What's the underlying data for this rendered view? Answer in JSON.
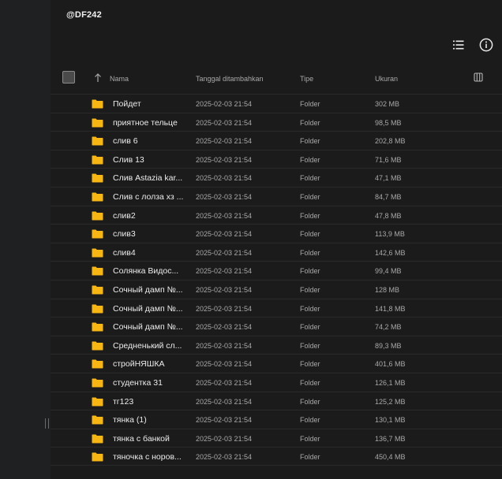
{
  "header": {
    "title": "@DF242"
  },
  "columns": {
    "name": "Nama",
    "date": "Tanggal ditambahkan",
    "type": "Tipe",
    "size": "Ukuran"
  },
  "colors": {
    "folder": "#f7b614",
    "background": "#1b1b1b",
    "sidebar": "#1f2022"
  },
  "rows": [
    {
      "name": "Пойдет",
      "date": "2025-02-03 21:54",
      "type": "Folder",
      "size": "302 MB"
    },
    {
      "name": "приятное тельце",
      "date": "2025-02-03 21:54",
      "type": "Folder",
      "size": "98,5 MB"
    },
    {
      "name": "слив 6",
      "date": "2025-02-03 21:54",
      "type": "Folder",
      "size": "202,8 MB"
    },
    {
      "name": "Слив 13",
      "date": "2025-02-03 21:54",
      "type": "Folder",
      "size": "71,6 MB"
    },
    {
      "name": "Слив Astazia kar...",
      "date": "2025-02-03 21:54",
      "type": "Folder",
      "size": "47,1 MB"
    },
    {
      "name": "Слив с лолза хз ...",
      "date": "2025-02-03 21:54",
      "type": "Folder",
      "size": "84,7 MB"
    },
    {
      "name": "слив2",
      "date": "2025-02-03 21:54",
      "type": "Folder",
      "size": "47,8 MB"
    },
    {
      "name": "слив3",
      "date": "2025-02-03 21:54",
      "type": "Folder",
      "size": "113,9 MB"
    },
    {
      "name": "слив4",
      "date": "2025-02-03 21:54",
      "type": "Folder",
      "size": "142,6 MB"
    },
    {
      "name": "Солянка Видос...",
      "date": "2025-02-03 21:54",
      "type": "Folder",
      "size": "99,4 MB"
    },
    {
      "name": "Сочный дамп №...",
      "date": "2025-02-03 21:54",
      "type": "Folder",
      "size": "128 MB"
    },
    {
      "name": "Сочный дамп №...",
      "date": "2025-02-03 21:54",
      "type": "Folder",
      "size": "141,8 MB"
    },
    {
      "name": "Сочный дамп №...",
      "date": "2025-02-03 21:54",
      "type": "Folder",
      "size": "74,2 MB"
    },
    {
      "name": "Средненький сл...",
      "date": "2025-02-03 21:54",
      "type": "Folder",
      "size": "89,3 MB"
    },
    {
      "name": "стройНЯШКА",
      "date": "2025-02-03 21:54",
      "type": "Folder",
      "size": "401,6 MB"
    },
    {
      "name": "студентка 31",
      "date": "2025-02-03 21:54",
      "type": "Folder",
      "size": "126,1 MB"
    },
    {
      "name": "тг123",
      "date": "2025-02-03 21:54",
      "type": "Folder",
      "size": "125,2 MB"
    },
    {
      "name": "тянка (1)",
      "date": "2025-02-03 21:54",
      "type": "Folder",
      "size": "130,1 MB"
    },
    {
      "name": "тянка с банкой",
      "date": "2025-02-03 21:54",
      "type": "Folder",
      "size": "136,7 MB"
    },
    {
      "name": "тяночка с норов...",
      "date": "2025-02-03 21:54",
      "type": "Folder",
      "size": "450,4 MB"
    }
  ]
}
